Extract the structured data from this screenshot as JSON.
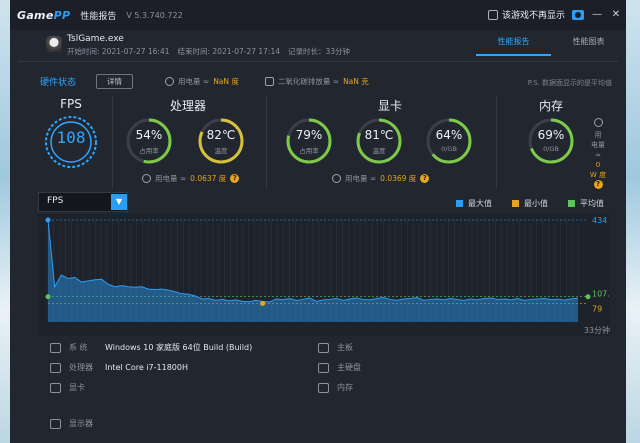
{
  "titlebar": {
    "logo_main": "Game",
    "logo_accent": "PP",
    "title": "性能报告",
    "version": "V 5.3.740.722",
    "hide_label": "该游戏不再显示"
  },
  "session": {
    "exe": "TslGame.exe",
    "start": "开始时间: 2021-07-27 16:41",
    "end": "结束时间: 2021-07-27 17:14",
    "duration": "记录时长：33分钟"
  },
  "tabs": [
    "性能报告",
    "性能图表"
  ],
  "hardware": {
    "title": "硬件状态",
    "detail_button": "详情",
    "power_label": "用电量 ≈",
    "power_value": "NaN 度",
    "co2_label": "二氧化碳排放量 ≈",
    "co2_value": "NaN 克",
    "ps_note": "P.S. 数据面显示的是平均值"
  },
  "fps": {
    "title": "FPS",
    "value": "108"
  },
  "cpu": {
    "title": "处理器",
    "usage": {
      "value": "54%",
      "label": "占用率",
      "fraction": 0.54
    },
    "temp": {
      "value": "82℃",
      "label": "温度",
      "fraction": 0.82
    },
    "power_label": "用电量 ≈",
    "power_value": "0.0637 度"
  },
  "gpu": {
    "title": "显卡",
    "usage": {
      "value": "79%",
      "label": "占用率",
      "fraction": 0.79
    },
    "temp": {
      "value": "81℃",
      "label": "温度",
      "fraction": 0.81
    },
    "mem": {
      "value": "64%",
      "label": "0/GB",
      "fraction": 0.64
    },
    "power_label": "用电量 ≈",
    "power_value": "0.0369 度"
  },
  "memory": {
    "title": "内存",
    "usage": {
      "value": "69%",
      "label": "0/GB",
      "fraction": 0.69
    },
    "power_label1": "用",
    "power_label2": "电量",
    "power_label3": "≈",
    "power_value1": "0",
    "power_value2": "W 度"
  },
  "colors": {
    "accent": "#2ea6ff",
    "green": "#7ec84a",
    "yellow": "#d4c13a",
    "orange": "#e6a41f",
    "max": "#2a9df4",
    "min": "#e6a41f",
    "avg": "#5cc45a"
  },
  "chart_data": {
    "type": "line",
    "metric_select": "FPS",
    "legend": [
      "最大值",
      "最小值",
      "平均值"
    ],
    "max_value": "434",
    "avg_value": "107.54",
    "min_value": "79",
    "x_end_label": "33分钟",
    "ylim": [
      0,
      434
    ],
    "series": [
      {
        "values": [
          434,
          150,
          200,
          185,
          190,
          170,
          175,
          180,
          182,
          160,
          150,
          155,
          150,
          148,
          150,
          140,
          138,
          140,
          135,
          128,
          120,
          118,
          110,
          98,
          100,
          92,
          96,
          90,
          94,
          88,
          86,
          92,
          88,
          85,
          98,
          95,
          100,
          92,
          96,
          102,
          88,
          94,
          96,
          100,
          92,
          98,
          102,
          96,
          94,
          100,
          104,
          96,
          92,
          98,
          100,
          104,
          92,
          96,
          98,
          94,
          100,
          96,
          92,
          98,
          94,
          100,
          102,
          96,
          98,
          94,
          100,
          92,
          96,
          98,
          100,
          95,
          97,
          93,
          99,
          101
        ]
      }
    ]
  },
  "system": {
    "os_label": "系 统",
    "os_value": "Windows 10 家庭版 64位   Build (Build)",
    "cpu_label": "处理器",
    "cpu_value": "Intel Core i7-11800H",
    "gpu_label": "显卡",
    "monitor_label": "显示器",
    "board_label": "主板",
    "disk_label": "主硬盘",
    "ram_label": "内存"
  }
}
